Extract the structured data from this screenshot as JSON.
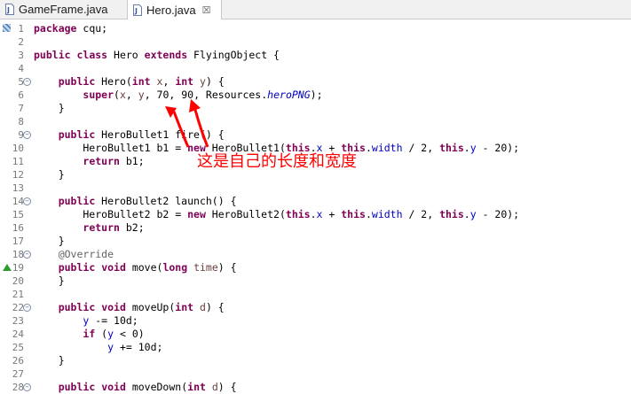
{
  "tabs": [
    {
      "label": "GameFrame.java",
      "active": false
    },
    {
      "label": "Hero.java",
      "active": true,
      "close": "☒"
    }
  ],
  "annotation": {
    "text": "这是自己的长度和宽度",
    "color": "#ff0000"
  },
  "colors": {
    "keyword": "#7f0055",
    "field": "#0000c0",
    "param": "#6a3e3e",
    "annotation": "#646464"
  },
  "lines": [
    {
      "n": "1",
      "marker": "bookmark",
      "tokens": [
        [
          "kw",
          "package"
        ],
        [
          "t",
          " cqu;"
        ]
      ]
    },
    {
      "n": "2",
      "tokens": []
    },
    {
      "n": "3",
      "tokens": [
        [
          "kw",
          "public"
        ],
        [
          "t",
          " "
        ],
        [
          "kw",
          "class"
        ],
        [
          "t",
          " Hero "
        ],
        [
          "kw",
          "extends"
        ],
        [
          "t",
          " FlyingObject {"
        ]
      ]
    },
    {
      "n": "4",
      "tokens": []
    },
    {
      "n": "5",
      "fold": true,
      "tokens": [
        [
          "t",
          "    "
        ],
        [
          "kw",
          "public"
        ],
        [
          "t",
          " Hero("
        ],
        [
          "kw",
          "int"
        ],
        [
          "t",
          " "
        ],
        [
          "param",
          "x"
        ],
        [
          "t",
          ", "
        ],
        [
          "kw",
          "int"
        ],
        [
          "t",
          " "
        ],
        [
          "param",
          "y"
        ],
        [
          "t",
          ") {"
        ]
      ]
    },
    {
      "n": "6",
      "tokens": [
        [
          "t",
          "        "
        ],
        [
          "kw",
          "super"
        ],
        [
          "t",
          "("
        ],
        [
          "param",
          "x"
        ],
        [
          "t",
          ", "
        ],
        [
          "param",
          "y"
        ],
        [
          "t",
          ", 70, 90, Resources."
        ],
        [
          "it",
          "heroPNG"
        ],
        [
          "t",
          ");"
        ]
      ]
    },
    {
      "n": "7",
      "tokens": [
        [
          "t",
          "    }"
        ]
      ]
    },
    {
      "n": "8",
      "tokens": []
    },
    {
      "n": "9",
      "fold": true,
      "tokens": [
        [
          "t",
          "    "
        ],
        [
          "kw",
          "public"
        ],
        [
          "t",
          " HeroBullet1 fire() {"
        ]
      ]
    },
    {
      "n": "10",
      "tokens": [
        [
          "t",
          "        HeroBullet1 b1 = "
        ],
        [
          "kw",
          "new"
        ],
        [
          "t",
          " HeroBullet1("
        ],
        [
          "kw",
          "this"
        ],
        [
          "t",
          "."
        ],
        [
          "fld",
          "x"
        ],
        [
          "t",
          " + "
        ],
        [
          "kw",
          "this"
        ],
        [
          "t",
          "."
        ],
        [
          "fld",
          "width"
        ],
        [
          "t",
          " / 2, "
        ],
        [
          "kw",
          "this"
        ],
        [
          "t",
          "."
        ],
        [
          "fld",
          "y"
        ],
        [
          "t",
          " - 20);"
        ]
      ]
    },
    {
      "n": "11",
      "tokens": [
        [
          "t",
          "        "
        ],
        [
          "kw",
          "return"
        ],
        [
          "t",
          " b1;"
        ]
      ]
    },
    {
      "n": "12",
      "tokens": [
        [
          "t",
          "    }"
        ]
      ]
    },
    {
      "n": "13",
      "tokens": []
    },
    {
      "n": "14",
      "fold": true,
      "tokens": [
        [
          "t",
          "    "
        ],
        [
          "kw",
          "public"
        ],
        [
          "t",
          " HeroBullet2 launch() {"
        ]
      ]
    },
    {
      "n": "15",
      "tokens": [
        [
          "t",
          "        HeroBullet2 b2 = "
        ],
        [
          "kw",
          "new"
        ],
        [
          "t",
          " HeroBullet2("
        ],
        [
          "kw",
          "this"
        ],
        [
          "t",
          "."
        ],
        [
          "fld",
          "x"
        ],
        [
          "t",
          " + "
        ],
        [
          "kw",
          "this"
        ],
        [
          "t",
          "."
        ],
        [
          "fld",
          "width"
        ],
        [
          "t",
          " / 2, "
        ],
        [
          "kw",
          "this"
        ],
        [
          "t",
          "."
        ],
        [
          "fld",
          "y"
        ],
        [
          "t",
          " - 20);"
        ]
      ]
    },
    {
      "n": "16",
      "tokens": [
        [
          "t",
          "        "
        ],
        [
          "kw",
          "return"
        ],
        [
          "t",
          " b2;"
        ]
      ]
    },
    {
      "n": "17",
      "tokens": [
        [
          "t",
          "    }"
        ]
      ]
    },
    {
      "n": "18",
      "fold": true,
      "tokens": [
        [
          "t",
          "    "
        ],
        [
          "ann",
          "@Override"
        ]
      ]
    },
    {
      "n": "19",
      "marker": "override",
      "tokens": [
        [
          "t",
          "    "
        ],
        [
          "kw",
          "public"
        ],
        [
          "t",
          " "
        ],
        [
          "kw",
          "void"
        ],
        [
          "t",
          " move("
        ],
        [
          "kw",
          "long"
        ],
        [
          "t",
          " "
        ],
        [
          "param",
          "time"
        ],
        [
          "t",
          ") {"
        ]
      ]
    },
    {
      "n": "20",
      "tokens": [
        [
          "t",
          "    }"
        ]
      ]
    },
    {
      "n": "21",
      "tokens": []
    },
    {
      "n": "22",
      "fold": true,
      "tokens": [
        [
          "t",
          "    "
        ],
        [
          "kw",
          "public"
        ],
        [
          "t",
          " "
        ],
        [
          "kw",
          "void"
        ],
        [
          "t",
          " moveUp("
        ],
        [
          "kw",
          "int"
        ],
        [
          "t",
          " "
        ],
        [
          "param",
          "d"
        ],
        [
          "t",
          ") {"
        ]
      ]
    },
    {
      "n": "23",
      "tokens": [
        [
          "t",
          "        "
        ],
        [
          "fld",
          "y"
        ],
        [
          "t",
          " -= 10d;"
        ]
      ]
    },
    {
      "n": "24",
      "tokens": [
        [
          "t",
          "        "
        ],
        [
          "kw",
          "if"
        ],
        [
          "t",
          " ("
        ],
        [
          "fld",
          "y"
        ],
        [
          "t",
          " < 0)"
        ]
      ]
    },
    {
      "n": "25",
      "tokens": [
        [
          "t",
          "            "
        ],
        [
          "fld",
          "y"
        ],
        [
          "t",
          " += 10d;"
        ]
      ]
    },
    {
      "n": "26",
      "tokens": [
        [
          "t",
          "    }"
        ]
      ]
    },
    {
      "n": "27",
      "tokens": []
    },
    {
      "n": "28",
      "fold": true,
      "tokens": [
        [
          "t",
          "    "
        ],
        [
          "kw",
          "public"
        ],
        [
          "t",
          " "
        ],
        [
          "kw",
          "void"
        ],
        [
          "t",
          " moveDown("
        ],
        [
          "kw",
          "int"
        ],
        [
          "t",
          " "
        ],
        [
          "param",
          "d"
        ],
        [
          "t",
          ") {"
        ]
      ]
    }
  ]
}
